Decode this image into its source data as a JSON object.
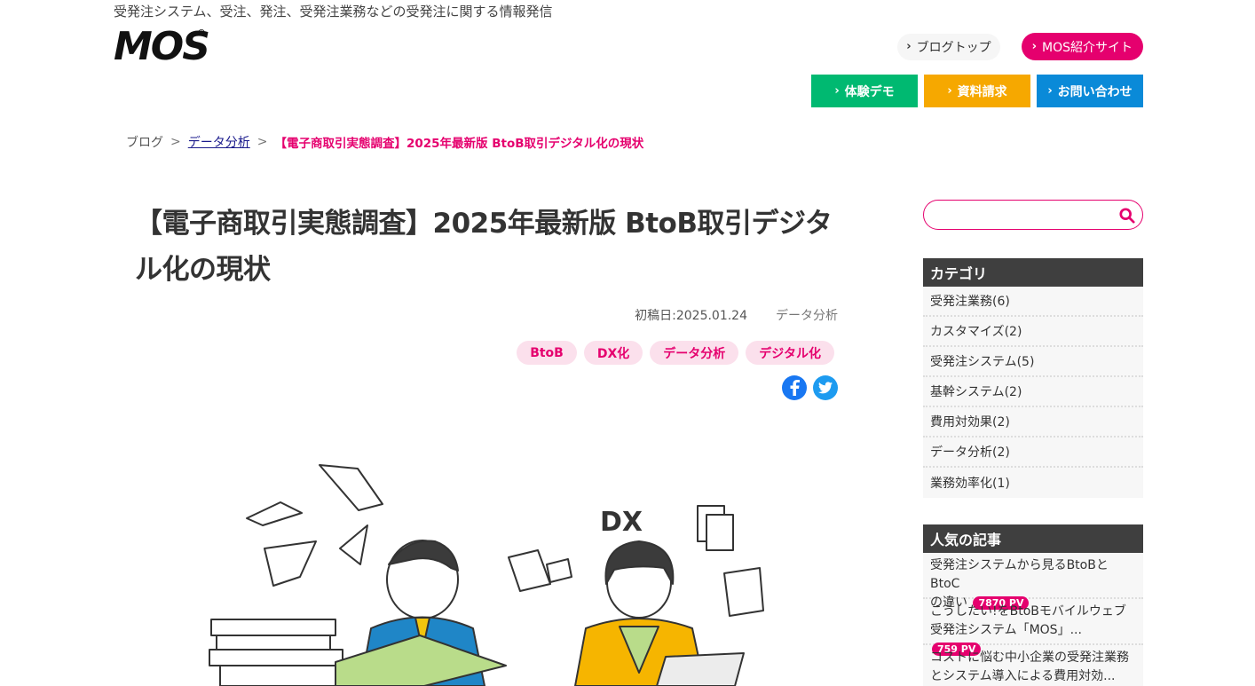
{
  "header": {
    "tagline": "受発注システム、受注、発注、受発注業務などの受発注に関する情報発信",
    "logo_text": "MOS",
    "logo_reg": "®",
    "blog_top_label": "ブログトップ",
    "mos_site_label": "MOS紹介サイト",
    "cta": [
      {
        "label": "体験デモ",
        "color": "#00b971"
      },
      {
        "label": "資料請求",
        "color": "#f6a800"
      },
      {
        "label": "お問い合わせ",
        "color": "#0a8ad8"
      }
    ]
  },
  "breadcrumb": {
    "home": "ブログ",
    "sep": ">",
    "category": "データ分析",
    "current": "【電子商取引実態調査】2025年最新版 BtoB取引デジタル化の現状"
  },
  "article": {
    "title": "【電子商取引実態調査】2025年最新版 BtoB取引デジタル化の現状",
    "posted": "初稿日:2025.01.24",
    "category": "データ分析",
    "tags": [
      "BtoB",
      "DX化",
      "データ分析",
      "デジタル化"
    ],
    "illustration_text": "DX"
  },
  "sidebar": {
    "search_placeholder": "",
    "categories_title": "カテゴリ",
    "categories": [
      "受発注業務(6)",
      "カスタマイズ(2)",
      "受発注システム(5)",
      "基幹システム(2)",
      "費用対効果(2)",
      "データ分析(2)",
      "業務効率化(1)"
    ],
    "popular_title": "人気の記事",
    "popular": [
      {
        "line1": "受発注システムから見るBtoBとBtoC",
        "line2": "の違い",
        "pv": "7870 PV"
      },
      {
        "line1": "こうしたい!をBtoBモバイルウェブ",
        "line2": "受発注システム「MOS」...",
        "pv": "759 PV"
      },
      {
        "line1": "コストに悩む中小企業の受発注業務",
        "line2": "とシステム導入による費用対効...",
        "pv": ""
      }
    ]
  },
  "colors": {
    "accent": "#e5006e",
    "facebook": "#1877f2",
    "twitter": "#1d9bf0"
  }
}
